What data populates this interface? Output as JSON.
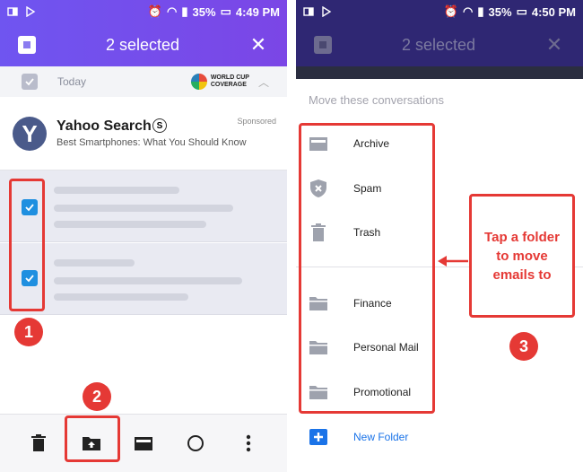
{
  "left_screen": {
    "status": {
      "battery": "35%",
      "time": "4:49 PM"
    },
    "appbar": {
      "title": "2 selected",
      "close": "✕"
    },
    "today": {
      "label": "Today",
      "badge_line1": "WORLD CUP",
      "badge_line2": "COVERAGE"
    },
    "ad": {
      "avatar_letter": "Y",
      "title": "Yahoo Search",
      "s_badge": "S",
      "subtitle": "Best Smartphones: What You Should Know",
      "sponsored": "Sponsored"
    },
    "bottom_bar": {
      "icons": [
        "trash-icon",
        "move-folder-icon",
        "archive-icon",
        "circle-icon",
        "more-vert-icon"
      ]
    }
  },
  "right_screen": {
    "status": {
      "battery": "35%",
      "time": "4:50 PM"
    },
    "appbar": {
      "title": "2 selected",
      "close": "✕"
    },
    "sheet": {
      "title": "Move these conversations",
      "items": [
        {
          "label": "Archive",
          "icon": "archive-icon"
        },
        {
          "label": "Spam",
          "icon": "spam-shield-icon"
        },
        {
          "label": "Trash",
          "icon": "trash-icon"
        },
        {
          "label": "Finance",
          "icon": "folder-icon"
        },
        {
          "label": "Personal Mail",
          "icon": "folder-icon"
        },
        {
          "label": "Promotional",
          "icon": "folder-icon"
        }
      ],
      "new_folder": "New Folder"
    }
  },
  "annotations": {
    "step1": "1",
    "step2": "2",
    "step3": "3",
    "callout_line1": "Tap a folder",
    "callout_line2": "to move",
    "callout_line3": "emails to",
    "accent_color": "#e53935"
  }
}
